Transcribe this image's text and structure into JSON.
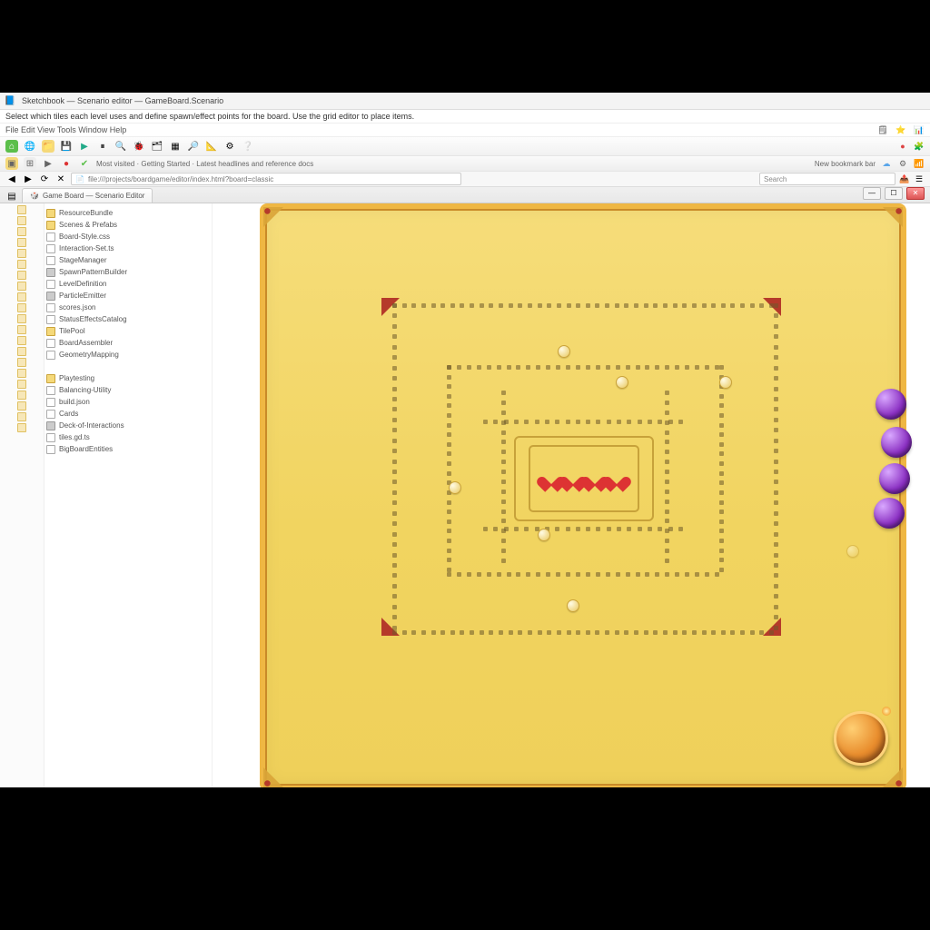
{
  "window": {
    "title": "Sketchbook — Scenario editor — GameBoard.Scenario",
    "description": "Select which tiles each level uses and define spawn/effect points for the board. Use the grid editor to place items.",
    "menubar_hint": "File   Edit   View   Tools   Window   Help"
  },
  "toolbar": {
    "icons": [
      "home",
      "globe",
      "folder",
      "save",
      "play",
      "pause",
      "search",
      "bug",
      "layers",
      "grid",
      "zoom",
      "ruler",
      "gear",
      "help"
    ]
  },
  "bookmarkbar": {
    "hint": "Most visited · Getting Started · Latest headlines and reference docs",
    "right_hint": "New bookmark bar"
  },
  "addressbar": {
    "url_text": "file:///projects/boardgame/editor/index.html?board=classic",
    "search_placeholder": "Search"
  },
  "tab": {
    "label": "Game Board — Scenario Editor"
  },
  "tree": {
    "items": [
      {
        "icon": "ifold",
        "label": "ResourceBundle"
      },
      {
        "icon": "ifold",
        "label": "Scenes & Prefabs"
      },
      {
        "icon": "ifile",
        "label": "Board-Style.css"
      },
      {
        "icon": "ifile",
        "label": "Interaction-Set.ts"
      },
      {
        "icon": "ifile",
        "label": "StageManager"
      },
      {
        "icon": "igear",
        "label": "SpawnPatternBuilder"
      },
      {
        "icon": "ifile",
        "label": "LevelDefinition"
      },
      {
        "icon": "igear",
        "label": "ParticleEmitter"
      },
      {
        "icon": "ifile",
        "label": "scores.json"
      },
      {
        "icon": "ifile",
        "label": "StatusEffectsCatalog"
      },
      {
        "icon": "ifold",
        "label": "TilePool"
      },
      {
        "icon": "ifile",
        "label": "BoardAssembler"
      },
      {
        "icon": "ifile",
        "label": "GeometryMapping"
      },
      {
        "icon": "",
        "label": ""
      },
      {
        "icon": "ifold",
        "label": "Playtesting"
      },
      {
        "icon": "ifile",
        "label": "Balancing-Utility"
      },
      {
        "icon": "ifile",
        "label": "build.json"
      },
      {
        "icon": "ifile",
        "label": "Cards"
      },
      {
        "icon": "igear",
        "label": "Deck-of-Interactions"
      },
      {
        "icon": "ifile",
        "label": "tiles.gd.ts"
      },
      {
        "icon": "ifile",
        "label": "BigBoardEntities"
      }
    ]
  },
  "game": {
    "orb_labels": [
      "orb-1",
      "orb-2",
      "orb-3",
      "orb-4"
    ],
    "sprite_count": 7,
    "hearts": 4,
    "bomb_label": "power-bomb"
  },
  "colors": {
    "board_fill": "#f3d868",
    "board_border": "#efb743",
    "accent_red": "#b53a2a",
    "orb_purple": "#8a2fc2",
    "bomb_orange": "#e98e2e"
  }
}
